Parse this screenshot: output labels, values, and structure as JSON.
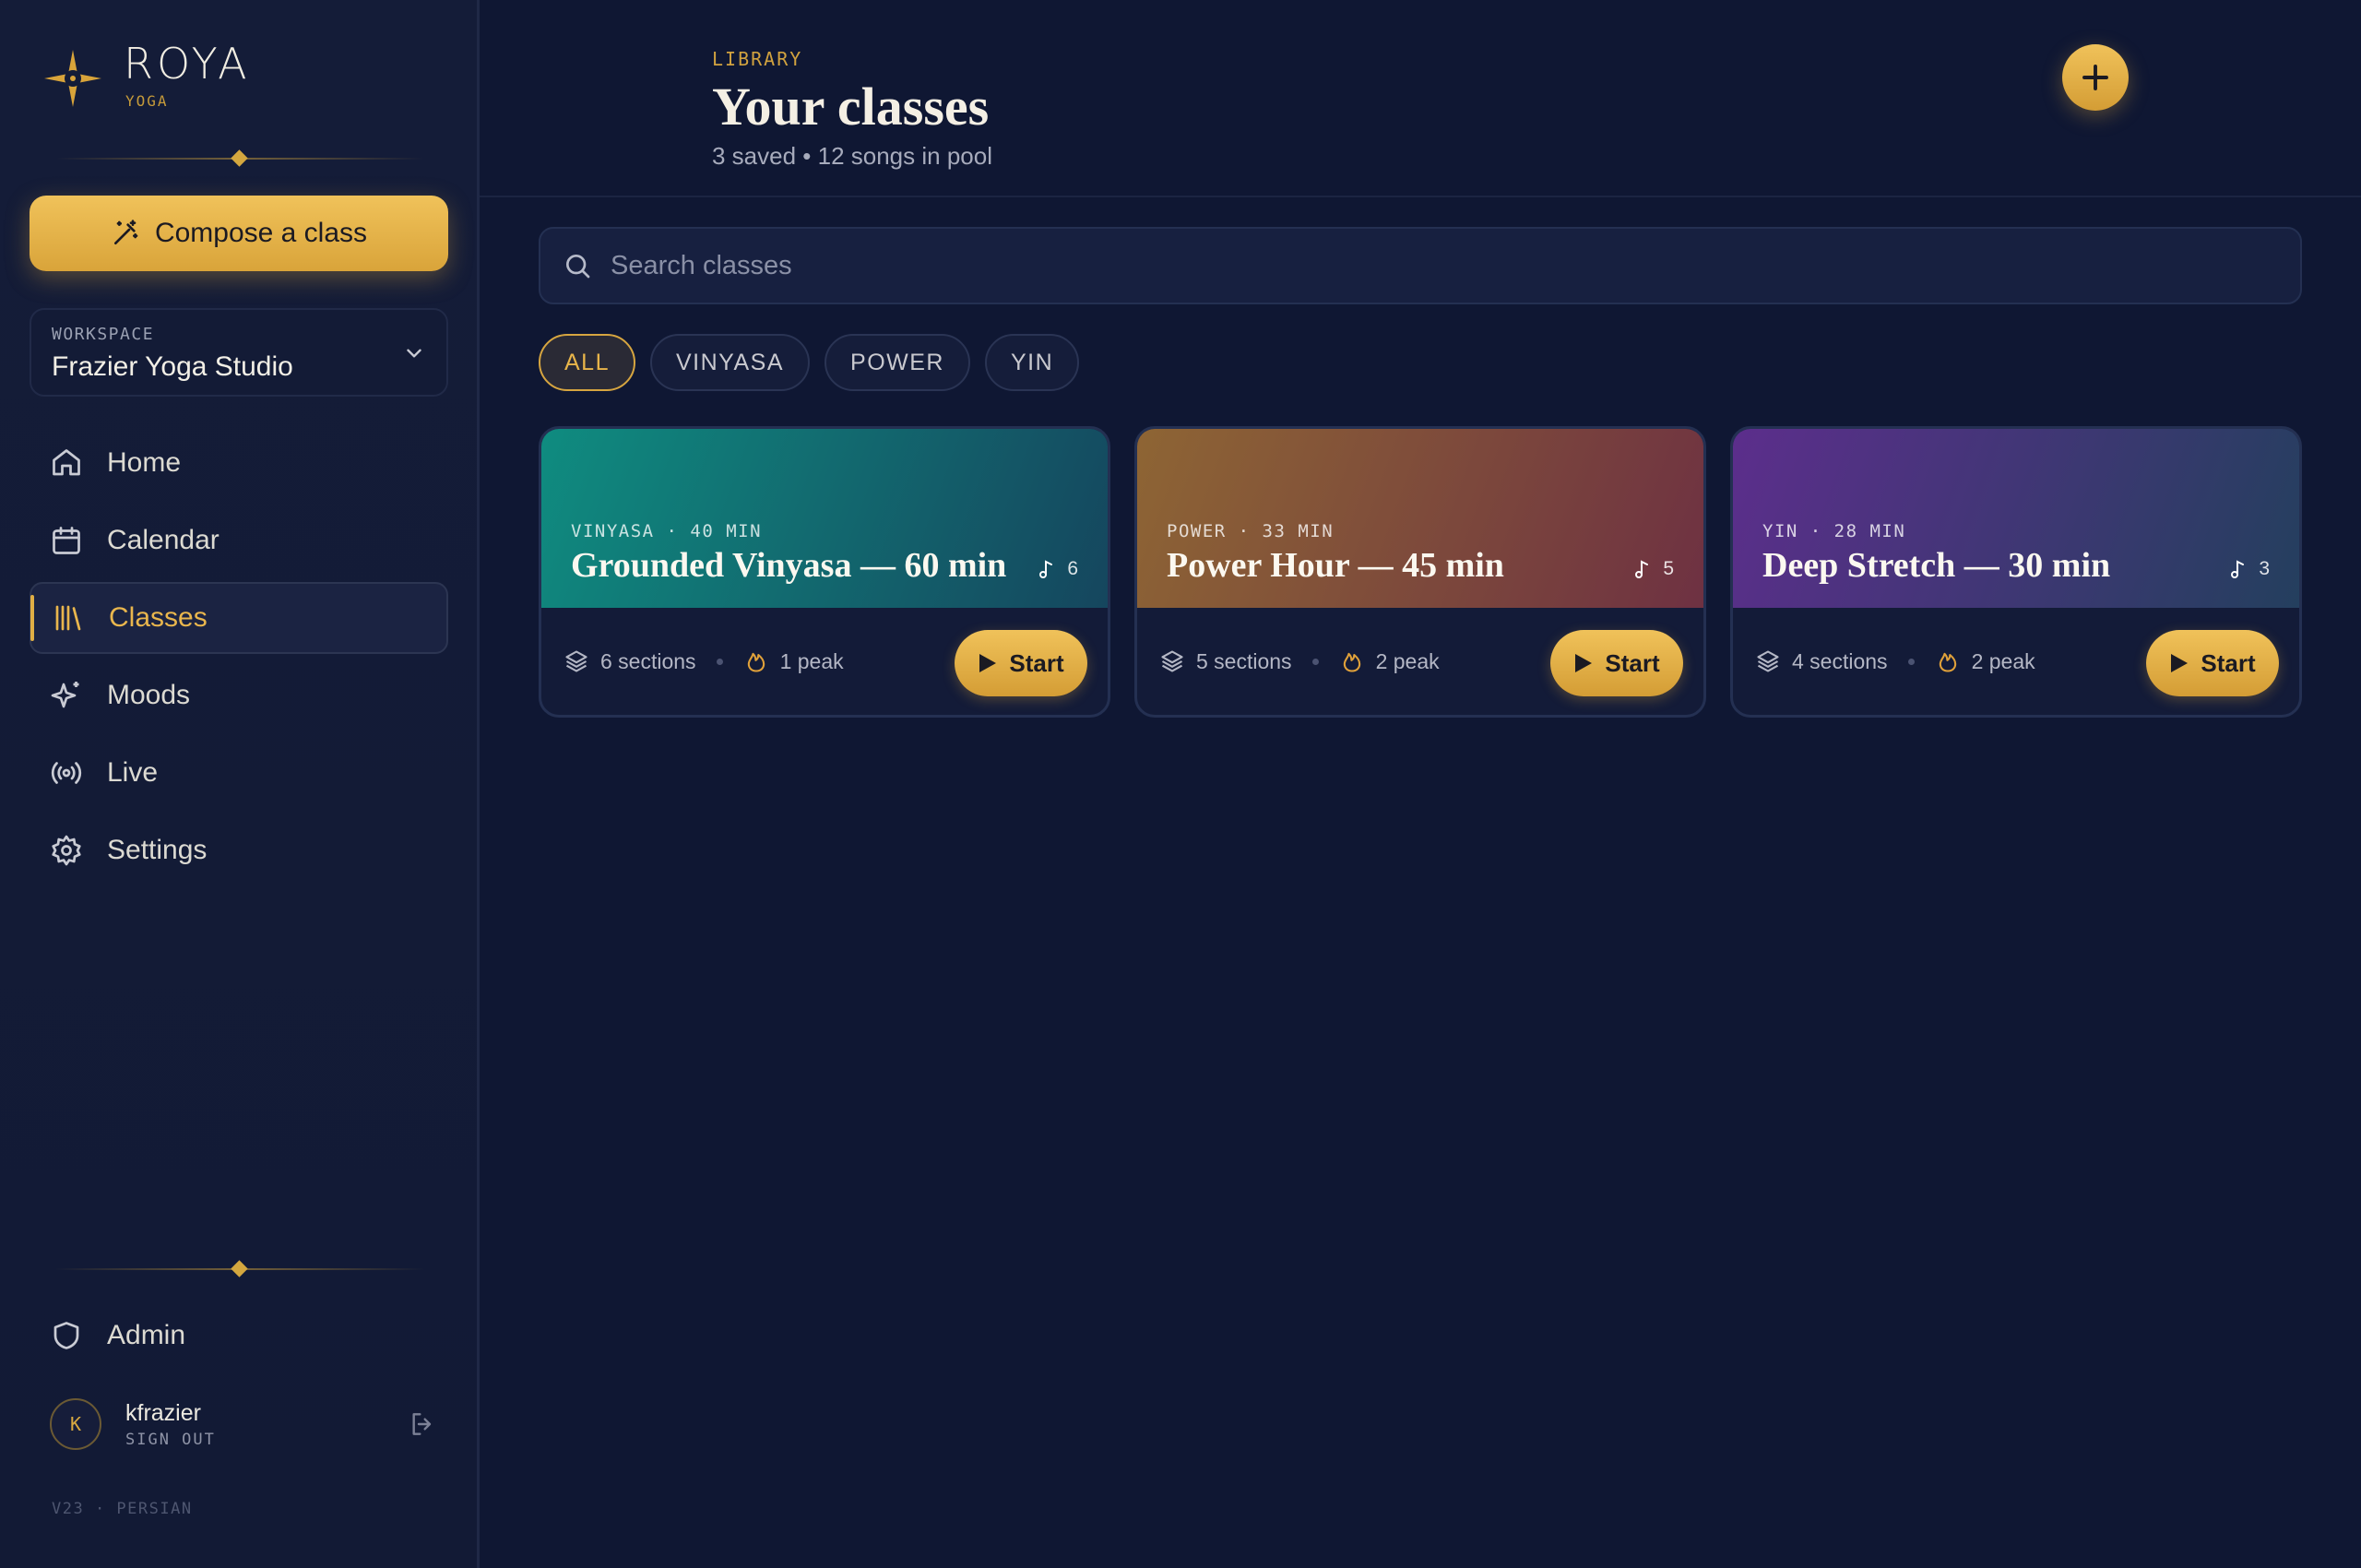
{
  "brand": {
    "name": "ROYA",
    "subtitle": "YOGA",
    "accent": "#d9a43a"
  },
  "sidebar": {
    "compose_label": "Compose a class",
    "workspace": {
      "label": "WORKSPACE",
      "name": "Frazier Yoga Studio"
    },
    "nav": [
      {
        "label": "Home",
        "icon": "home-icon"
      },
      {
        "label": "Calendar",
        "icon": "calendar-icon"
      },
      {
        "label": "Classes",
        "icon": "library-icon",
        "active": true
      },
      {
        "label": "Moods",
        "icon": "sparkles-icon"
      },
      {
        "label": "Live",
        "icon": "broadcast-icon"
      },
      {
        "label": "Settings",
        "icon": "gear-icon"
      }
    ],
    "admin_label": "Admin",
    "user": {
      "initial": "K",
      "name": "kfrazier",
      "action": "SIGN OUT"
    },
    "version": "V23 · PERSIAN"
  },
  "header": {
    "eyebrow": "LIBRARY",
    "title": "Your classes",
    "subtitle": "3 saved • 12 songs in pool"
  },
  "search": {
    "placeholder": "Search classes",
    "value": ""
  },
  "filters": {
    "selected": "ALL",
    "options": [
      "ALL",
      "VINYASA",
      "POWER",
      "YIN"
    ]
  },
  "cards": [
    {
      "meta": "VINYASA · 40 MIN",
      "title": "Grounded Vinyasa — 60 min",
      "songs": "6",
      "sections": "6 sections",
      "peak": "1 peak",
      "start_label": "Start",
      "gradient_from": "#0f8c80",
      "gradient_to": "#15465e"
    },
    {
      "meta": "POWER · 33 MIN",
      "title": "Power Hour — 45 min",
      "songs": "5",
      "sections": "5 sections",
      "peak": "2 peak",
      "start_label": "Start",
      "gradient_from": "#8e6534",
      "gradient_to": "#6e3142"
    },
    {
      "meta": "YIN · 28 MIN",
      "title": "Deep Stretch — 30 min",
      "songs": "3",
      "sections": "4 sections",
      "peak": "2 peak",
      "start_label": "Start",
      "gradient_from": "#5c2e8c",
      "gradient_to": "#243f5e"
    }
  ]
}
